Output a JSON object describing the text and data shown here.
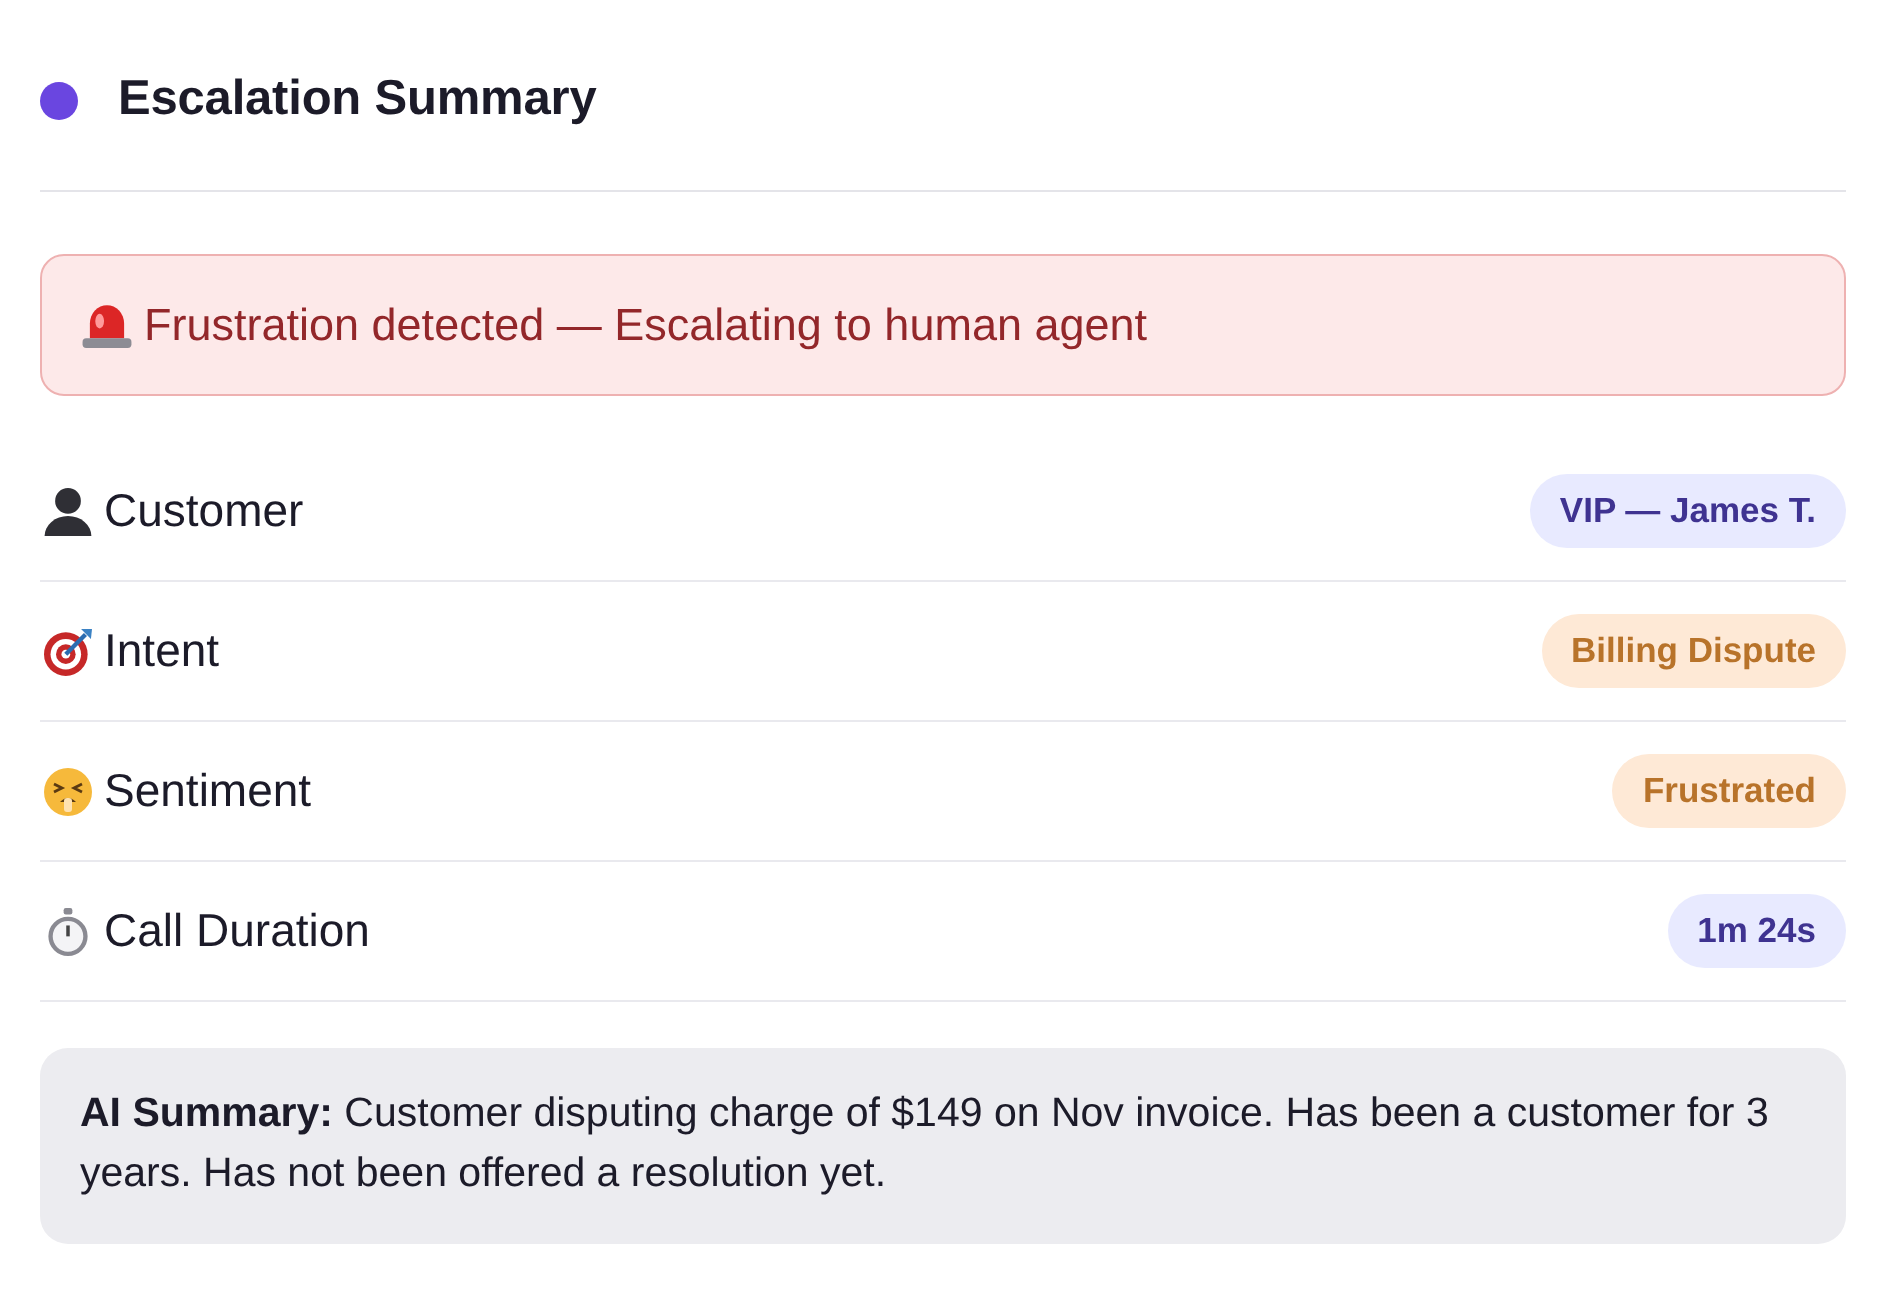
{
  "header": {
    "title": "Escalation Summary"
  },
  "alert": {
    "text": "Frustration detected — Escalating to human agent"
  },
  "rows": [
    {
      "label": "Customer",
      "value": "VIP — James T.",
      "color": "#3f3391"
    },
    {
      "label": "Intent",
      "value": "Billing Dispute",
      "color": "#b8732a"
    },
    {
      "label": "Sentiment",
      "value": "Frustrated",
      "color": "#b8732a"
    },
    {
      "label": "Call Duration",
      "value": "1m 24s",
      "color": "#3f3391"
    }
  ],
  "summary": {
    "text": "**AI Summary:** Customer disputing charge of $149 on Nov invoice. Has been a customer for 3 years. Has not been offered a resolution yet."
  }
}
